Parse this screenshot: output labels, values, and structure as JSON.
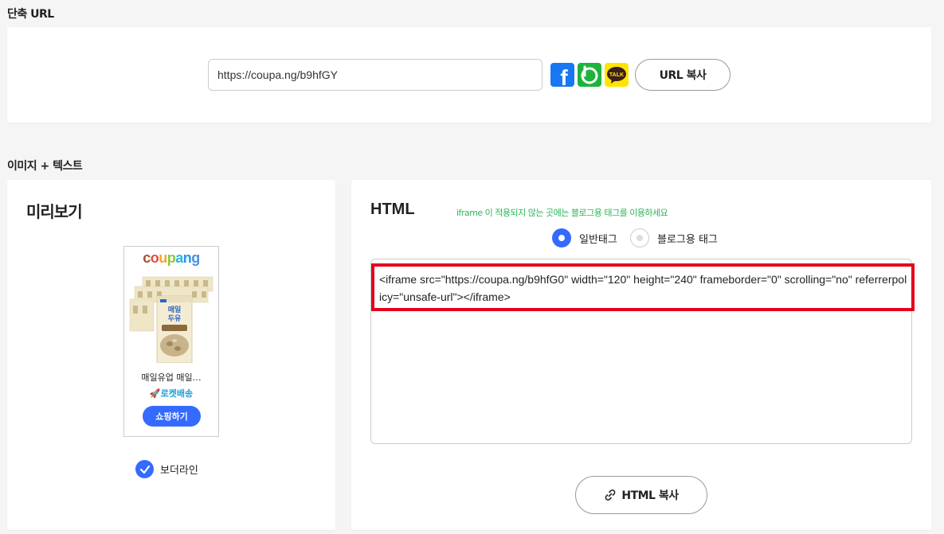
{
  "short_url": {
    "section_title": "단축 URL",
    "url_value": "https://coupa.ng/b9hfGY",
    "share": [
      {
        "name": "facebook-icon",
        "glyph": "f"
      },
      {
        "name": "band-icon",
        "glyph": "b"
      },
      {
        "name": "kakaotalk-icon",
        "glyph": "TALK"
      }
    ],
    "copy_label": "URL 복사"
  },
  "image_text": {
    "section_title": "이미지 + 텍스트",
    "preview": {
      "title": "미리보기",
      "logo_text": "coupang",
      "product_name": "매일유업 매일…",
      "rocket_label": "로켓배송",
      "shop_label": "쇼핑하기",
      "border_label": "보더라인"
    },
    "html": {
      "title": "HTML",
      "hint": "iframe 이 적용되지 않는 곳에는 블로그용 태그를 이용하세요",
      "radio_normal": "일반태그",
      "radio_blog": "블로그용 태그",
      "code": "<iframe src=\"https://coupa.ng/b9hfG0\" width=\"120\" height=\"240\" frameborder=\"0\" scrolling=\"no\" referrerpolicy=\"unsafe-url\"></iframe>",
      "copy_label": "HTML 복사"
    }
  },
  "colors": {
    "accent": "#346aff",
    "highlight": "#e4001b",
    "hint": "#2db45a",
    "rocket": "#1b9fd6"
  }
}
